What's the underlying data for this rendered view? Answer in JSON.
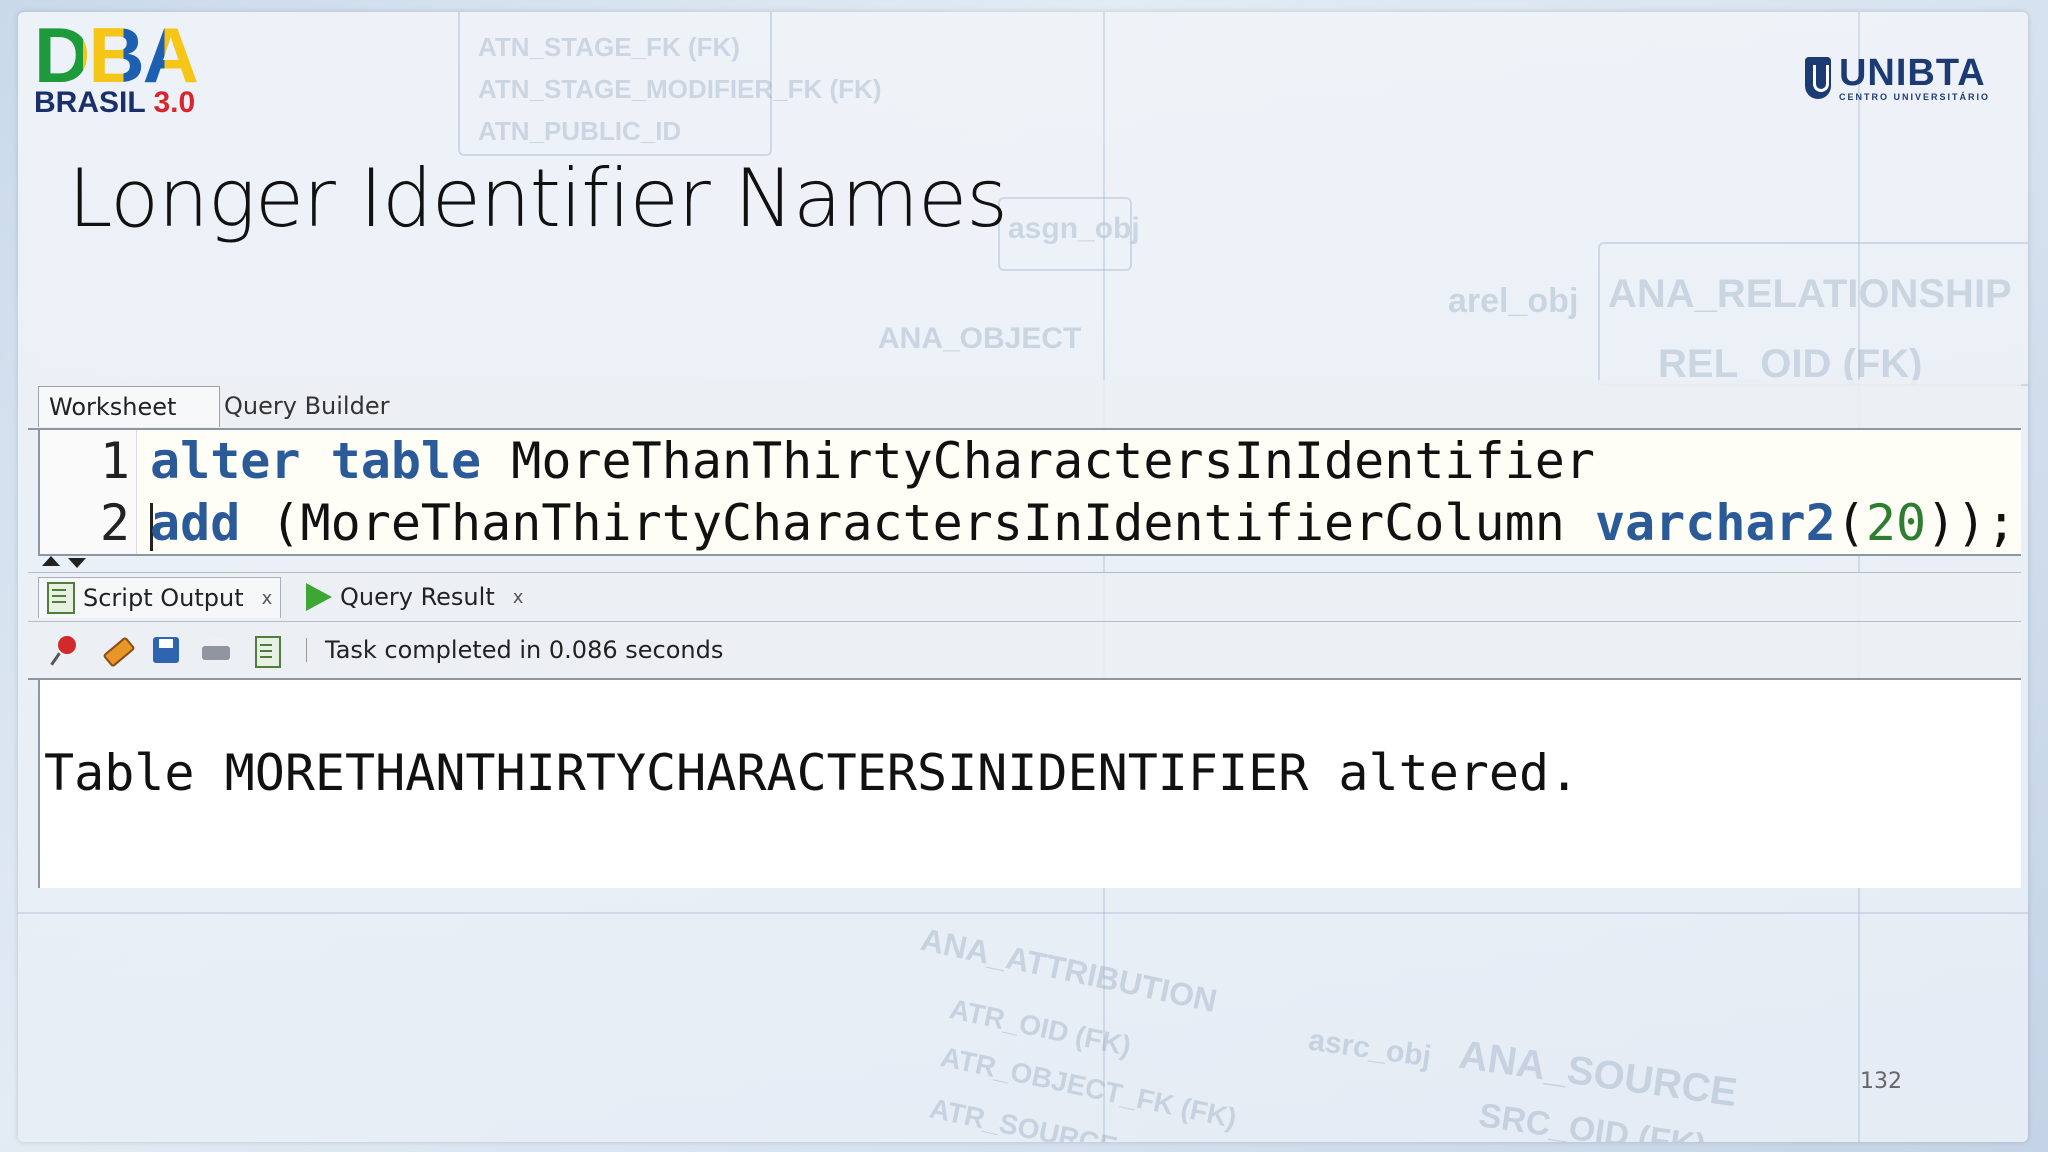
{
  "slide": {
    "title": "Longer Identifier Names",
    "page_number": "132"
  },
  "logos": {
    "left_big": "DBA",
    "left_sub": "BRASIL",
    "left_version": "3.0",
    "right_name": "UNIBTA",
    "right_tagline": "CENTRO UNIVERSITÁRIO"
  },
  "background_text": [
    "ATN_STAGE_FK (FK)",
    "ATN_STAGE_MODIFIER_FK (FK)",
    "ATN_PUBLIC_ID",
    "asgn_obj",
    "ANA_OBJECT",
    "ANA_RELATIONSHIP",
    "REL_OID (FK)",
    "arel_obj",
    "ANA_ATTRIBUTION",
    "ATR_OID (FK)",
    "ATR_OBJECT_FK (FK)",
    "ATR_SOURCE",
    "ANA_SOURCE",
    "SRC_OID (FK)",
    "asrc_obj"
  ],
  "editor": {
    "tabs": [
      "Worksheet",
      "Query Builder"
    ],
    "active_tab": "Worksheet",
    "lines": [
      {
        "number": "1",
        "kw1": "alter",
        "kw2": "table",
        "rest": "MoreThanThirtyCharactersInIdentifier"
      },
      {
        "number": "2",
        "kw1": "add",
        "mid": " (MoreThanThirtyCharactersInIdentifierColumn ",
        "type": "varchar2",
        "open": "(",
        "num": "20",
        "close": "));"
      }
    ]
  },
  "output_panel": {
    "tabs": [
      {
        "label": "Script Output",
        "icon": "script-output-icon",
        "close": "x"
      },
      {
        "label": "Query Result",
        "icon": "play-icon",
        "close": "x"
      }
    ],
    "toolbar_icons": [
      "pin-icon",
      "eraser-icon",
      "save-icon",
      "print-icon",
      "document-icon"
    ],
    "status": "Task completed in 0.086 seconds",
    "result_text": "Table MORETHANTHIRTYCHARACTERSINIDENTIFIER altered."
  },
  "colors": {
    "keyword": "#2b5a98",
    "number": "#2e7d32",
    "editor_bg": "#fffef6"
  }
}
